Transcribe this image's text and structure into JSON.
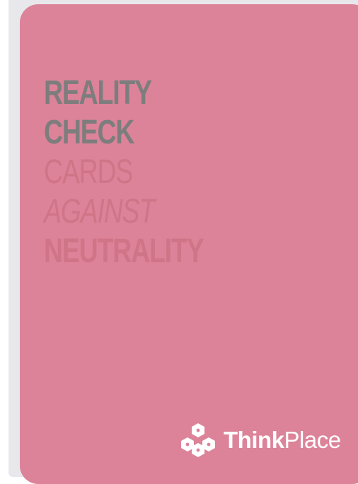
{
  "card": {
    "title_lines": [
      "REALITY",
      "CHECK"
    ],
    "subtitle_lines": [
      "CARDS",
      "AGAINST",
      "NEUTRALITY"
    ],
    "brand": {
      "name_bold": "Think",
      "name_regular": "Place",
      "icon": "thinkplace-logo-icon"
    }
  },
  "colors": {
    "card_background": "#dc8399",
    "title_text": "#7d7d7d",
    "subtitle_text": "#d07488",
    "brand_text": "#ffffff"
  }
}
